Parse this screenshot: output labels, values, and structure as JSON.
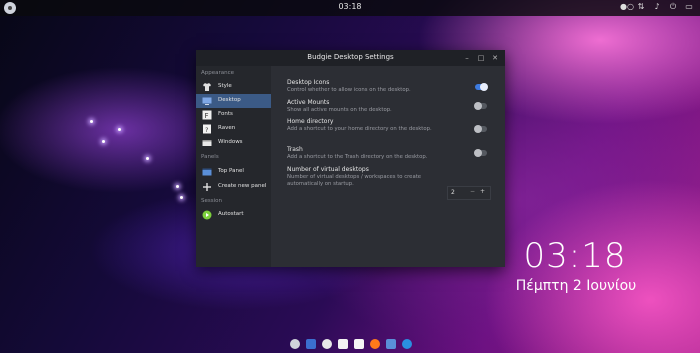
{
  "topbar": {
    "time": "03:18"
  },
  "desktop": {
    "clock": "03:18",
    "date": "Πέμπτη  2 Ιουνίου"
  },
  "window": {
    "title": "Budgie Desktop Settings",
    "controls": [
      "–",
      "□",
      "✕"
    ]
  },
  "sidebar": {
    "sections": {
      "appearance": "Appearance",
      "panels": "Panels",
      "session": "Session"
    },
    "items": [
      {
        "label": "Style",
        "icon": "shirt-icon"
      },
      {
        "label": "Desktop",
        "icon": "desktop-icon",
        "active": true
      },
      {
        "label": "Fonts",
        "icon": "font-icon"
      },
      {
        "label": "Raven",
        "icon": "raven-icon"
      },
      {
        "label": "Windows",
        "icon": "window-icon"
      },
      {
        "label": "Top Panel",
        "icon": "panel-icon"
      },
      {
        "label": "Create new panel",
        "icon": "plus-icon"
      },
      {
        "label": "Autostart",
        "icon": "autostart-icon"
      }
    ]
  },
  "content": {
    "options": [
      {
        "title": "Desktop Icons",
        "desc": "Control whether to allow icons on the desktop.",
        "on": true
      },
      {
        "title": "Active Mounts",
        "desc": "Show all active mounts on the desktop.",
        "on": false
      },
      {
        "title": "Home directory",
        "desc": "Add a shortcut to your home directory on the desktop.",
        "on": false
      },
      {
        "title": "Trash",
        "desc": "Add a shortcut to the Trash directory on the desktop.",
        "on": false
      },
      {
        "title": "Number of virtual desktops",
        "desc": "Number of virtual desktops / workspaces to create automatically on startup."
      }
    ],
    "virtual_desktops": {
      "value": "2",
      "minus": "−",
      "plus": "+"
    }
  },
  "colors": {
    "accent": "#3d7be0",
    "sidebar_active": "#3b5a86"
  }
}
